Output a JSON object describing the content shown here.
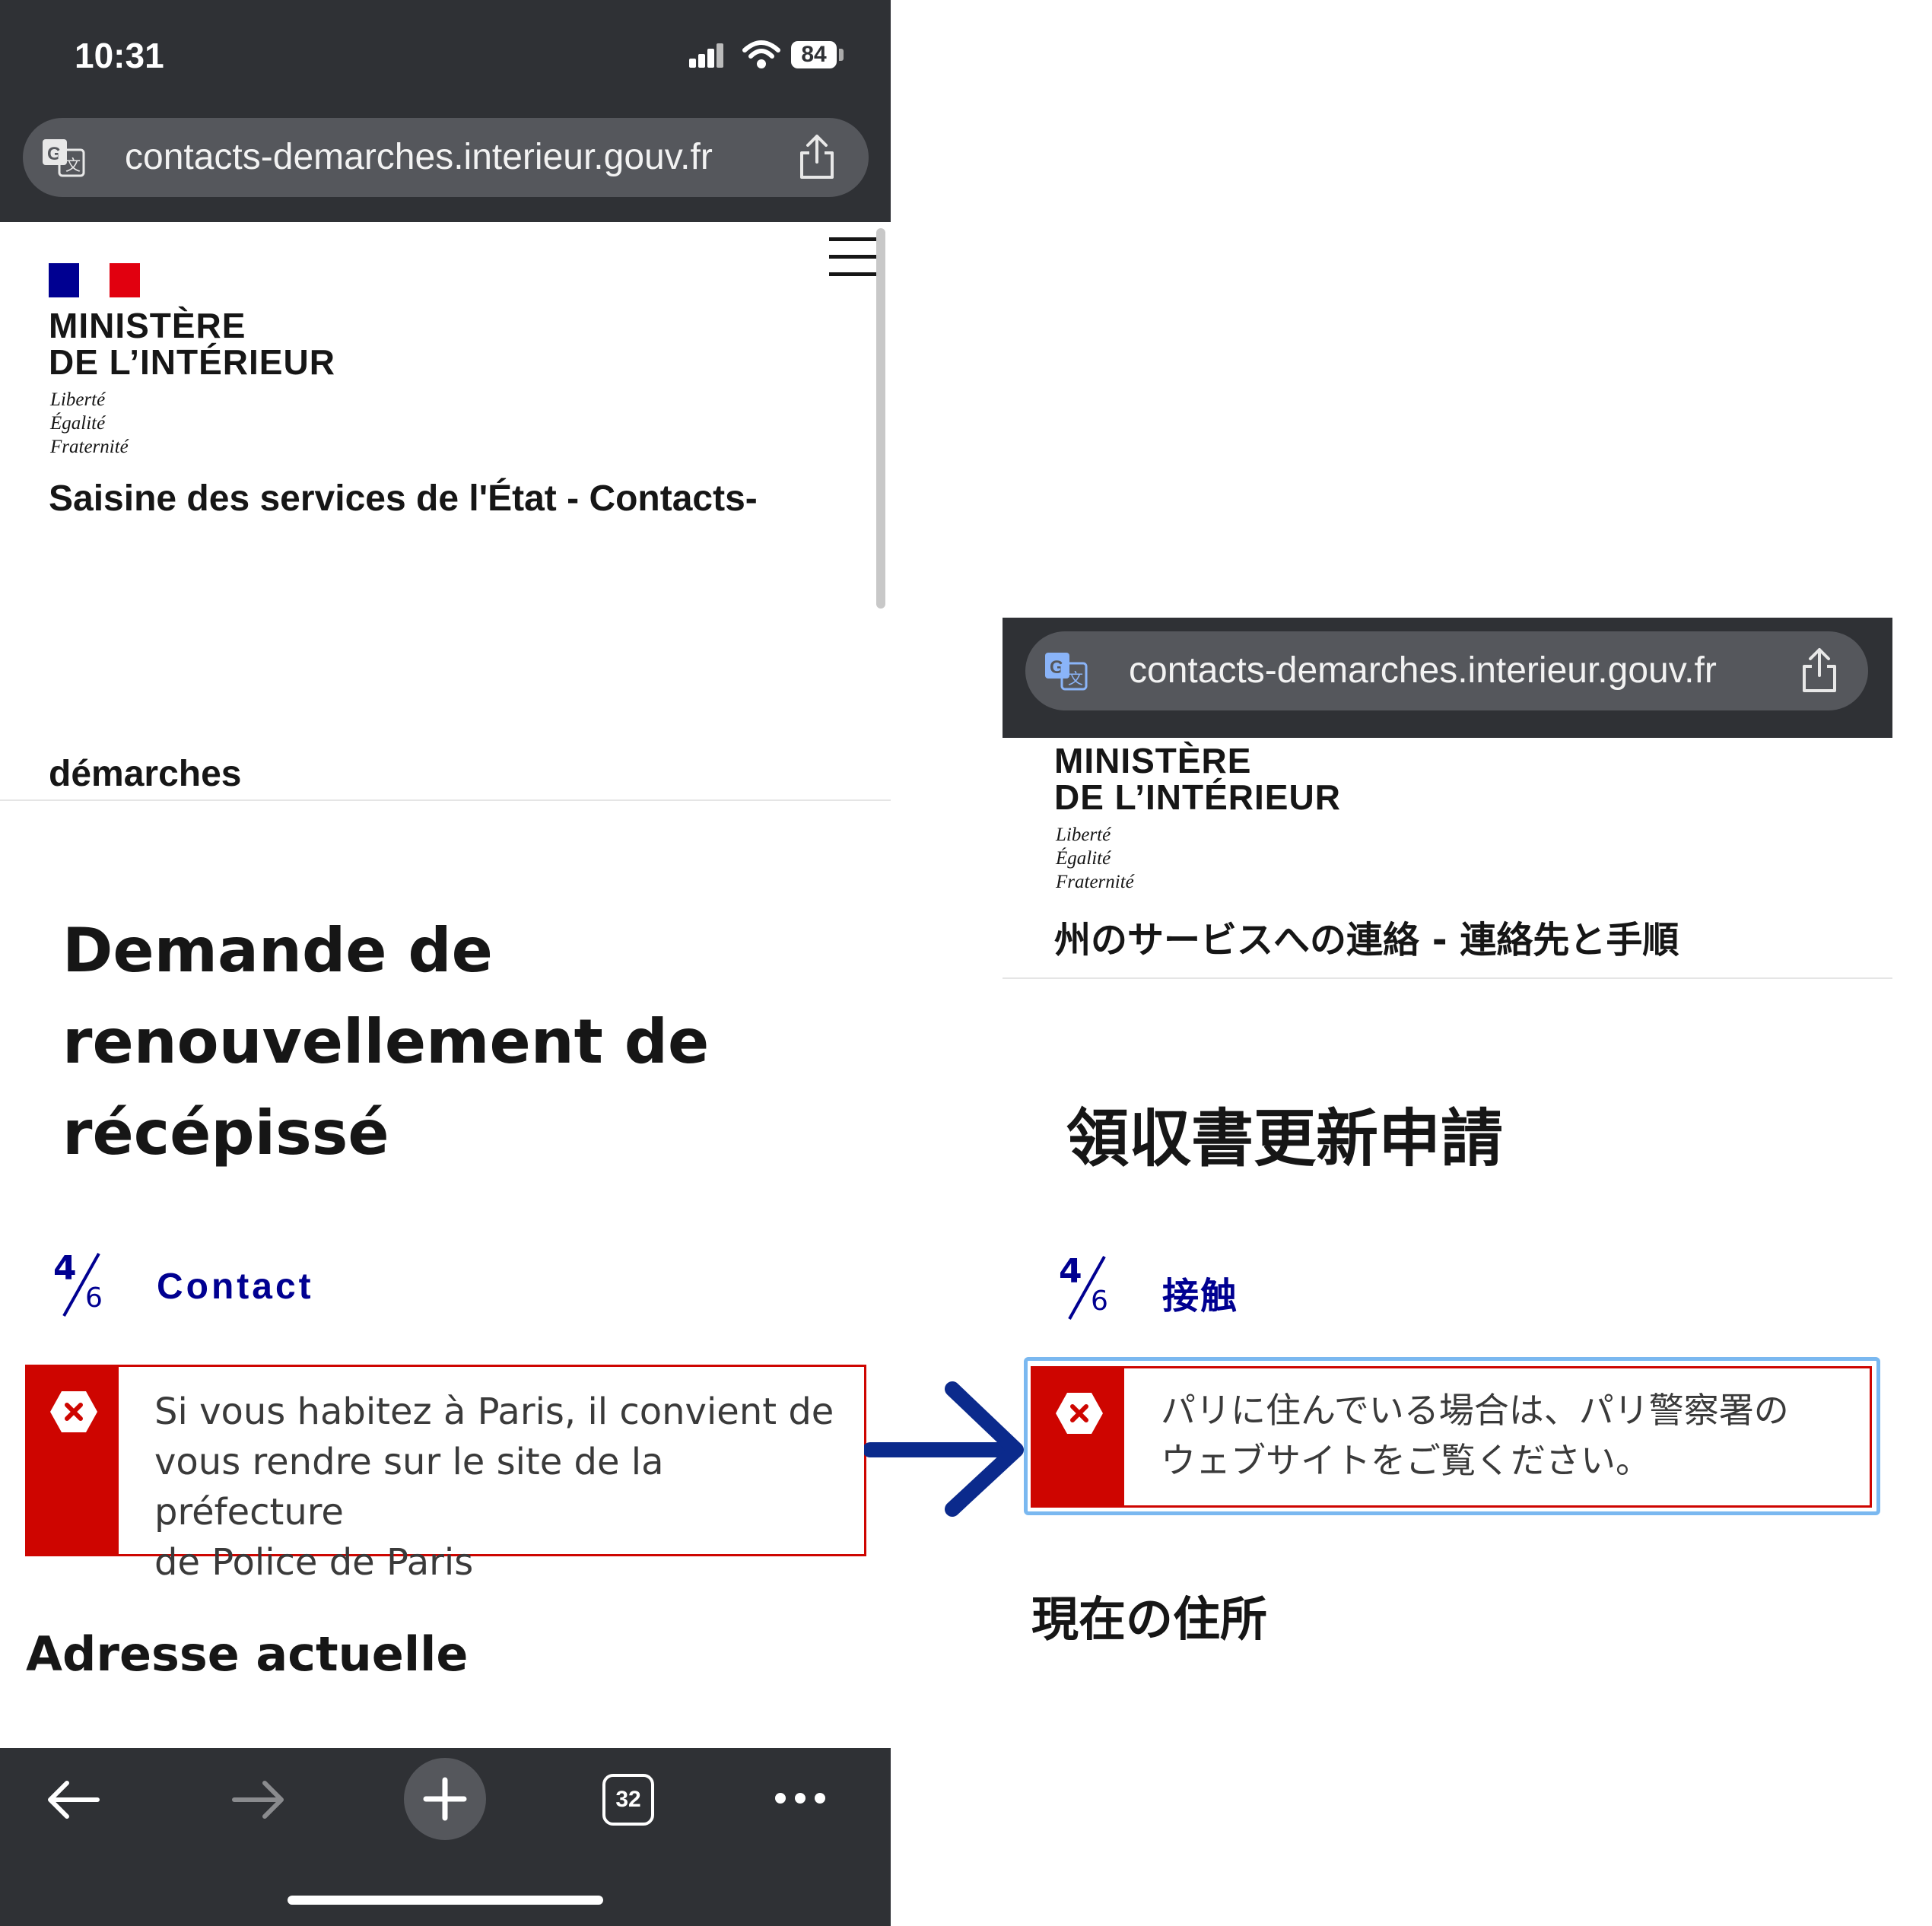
{
  "status_bar": {
    "time": "10:31",
    "battery": "84"
  },
  "left": {
    "url": "contacts-demarches.interieur.gouv.fr",
    "ministry_line1": "MINISTÈRE",
    "ministry_line2": "DE L’INTÉRIEUR",
    "motto": [
      "Liberté",
      "Égalité",
      "Fraternité"
    ],
    "service_line1": "Saisine des services de l'État - Contacts-",
    "service_line2": "démarches",
    "page_title": [
      "Demande de",
      "renouvellement de",
      "récépissé"
    ],
    "step": {
      "current": "4",
      "total": "6",
      "title": "Contact"
    },
    "alert_lines": [
      "Si vous habitez à Paris, il convient de",
      "vous rendre sur le site de la préfecture",
      "de Police de Paris"
    ],
    "section_heading": "Adresse actuelle",
    "tab_count": "32"
  },
  "right": {
    "url": "contacts-demarches.interieur.gouv.fr",
    "ministry_line1": "MINISTÈRE",
    "ministry_line2": "DE L’INTÉRIEUR",
    "motto": [
      "Liberté",
      "Égalité",
      "Fraternité"
    ],
    "service": "州のサービスへの連絡 - 連絡先と手順",
    "page_title": "領収書更新申請",
    "step": {
      "current": "4",
      "total": "6",
      "title": "接触"
    },
    "alert_lines": [
      "パリに住んでいる場合は、パリ警察署の",
      "ウェブサイトをご覧ください。"
    ],
    "section_heading": "現在の住所"
  },
  "colors": {
    "accent_blue": "#000091",
    "error_red": "#ce0500",
    "chrome_dark": "#2f3135",
    "arrow_blue": "#0b2a8c"
  },
  "icons": [
    "translate-icon",
    "share-icon",
    "menu-icon",
    "error-icon",
    "back-arrow-icon",
    "forward-arrow-icon",
    "new-tab-plus-icon",
    "more-icon",
    "annotation-arrow-icon"
  ]
}
